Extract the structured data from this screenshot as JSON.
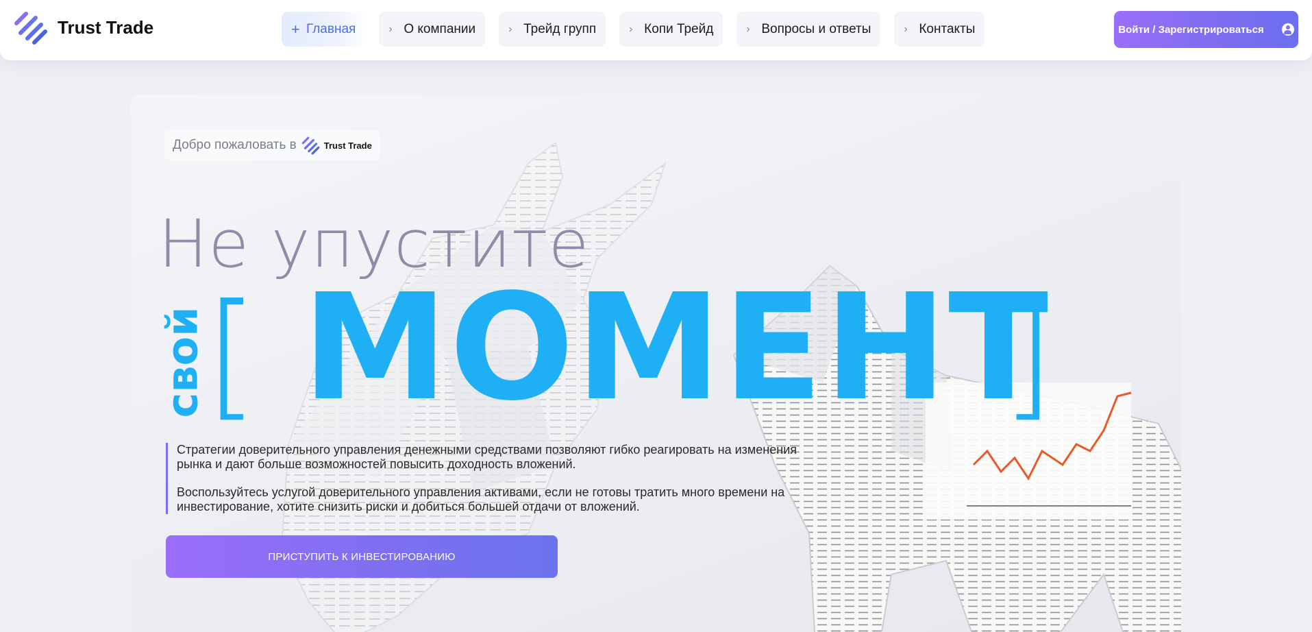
{
  "brand": {
    "name": "Trust Trade"
  },
  "nav": {
    "items": [
      {
        "label": "Главная",
        "active": true
      },
      {
        "label": "О компании",
        "active": false
      },
      {
        "label": "Трейд групп",
        "active": false
      },
      {
        "label": "Копи Трейд",
        "active": false
      },
      {
        "label": "Вопросы и ответы",
        "active": false
      },
      {
        "label": "Контакты",
        "active": false
      }
    ],
    "login_label": "Войти / Зарегистрироваться"
  },
  "hero": {
    "welcome_text": "Добро пожаловать в",
    "welcome_brand": "Trust Trade",
    "headline": "Не упустите",
    "vertical_word": "свой",
    "bracket_open": "[",
    "big_word": "МОМЕНТ",
    "bracket_close": "]",
    "paragraph_1": "Стратегии доверительного управления денежными средствами позволяют гибко реагировать на изменения рынка и дают больше возможностей повысить доходность вложений.",
    "paragraph_2": "Воспользуйтесь услугой доверительного управления активами, если не готовы тратить много времени на инвестирование, хотите снизить риски и добиться большей отдачи от вложений.",
    "cta_label": "ПРИСТУПИТЬ К ИНВЕСТИРОВАНИЮ"
  },
  "colors": {
    "accent_blue": "#1eaff5",
    "accent_purple": "#7c6df0",
    "headline_gray": "#8e8ca8",
    "nav_active": "#4f6ee0"
  },
  "icons": [
    "logo-icon",
    "plus-icon",
    "chevron-right-icon",
    "user-icon"
  ]
}
